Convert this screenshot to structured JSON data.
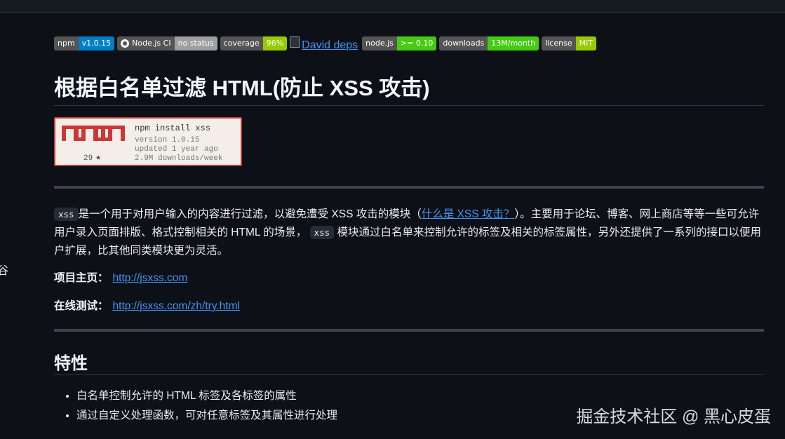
{
  "badges": [
    {
      "label": "npm",
      "value": "v1.0.15",
      "color": "#007ec6",
      "icon": ""
    },
    {
      "label": "Node.js CI",
      "value": "no status",
      "color": "#9f9f9f",
      "icon": "github-icon"
    },
    {
      "label": "coverage",
      "value": "96%",
      "color": "#97ca00",
      "icon": ""
    },
    {
      "label": "node.js",
      "value": ">= 0.10",
      "color": "#4c1",
      "icon": ""
    },
    {
      "label": "downloads",
      "value": "13M/month",
      "color": "#4c1",
      "icon": ""
    },
    {
      "label": "license",
      "value": "MIT",
      "color": "#97ca00",
      "icon": ""
    }
  ],
  "broken_image_alt": "David deps",
  "title": "根据白名单过滤 HTML(防止 XSS 攻击)",
  "npm_card": {
    "logo": "npm",
    "stars": "29",
    "command": "npm install xss",
    "version": "version 1.0.15",
    "updated": "updated 1 year ago",
    "downloads": "2.9M downloads/week",
    "accent": "#cb3837"
  },
  "intro": {
    "code1": "xss",
    "text1": "是一个用于对用户输入的内容进行过滤，以避免遭受 XSS 攻击的模块（",
    "link": "什么是 XSS 攻击？",
    "text2": "）。主要用于论坛、博客、网上商店等等一些可允许用户录入页面排版、格式控制相关的 HTML 的场景，",
    "code2": "xss",
    "text3": "模块通过白名单来控制允许的标签及相关的标签属性，另外还提供了一系列的接口以便用户扩展，比其他同类模块更为灵活。"
  },
  "homepage": {
    "label": "项目主页：",
    "url": "http://jsxss.com"
  },
  "demo": {
    "label": "在线测试：",
    "url": "http://jsxss.com/zh/try.html"
  },
  "features": {
    "heading": "特性",
    "items": [
      "白名单控制允许的 HTML 标签及各标签的属性",
      "通过自定义处理函数，可对任意标签及其属性进行处理"
    ]
  },
  "watermark": "掘金技术社区 @ 黑心皮蛋",
  "left_glyph": "谷"
}
